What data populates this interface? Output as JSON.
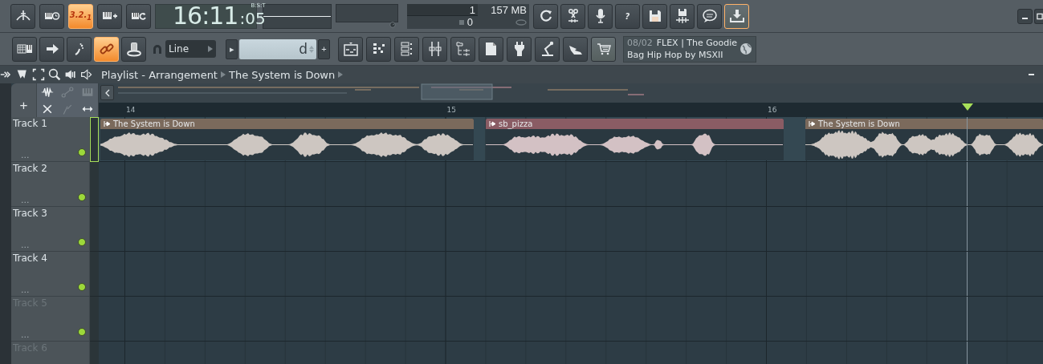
{
  "toolbar": {
    "transport_buttons": [
      {
        "on": false
      },
      {
        "on": false
      },
      {
        "on": true,
        "label": "3.2.$_{1}$"
      },
      {
        "on": false
      },
      {
        "on": false
      }
    ],
    "clock": {
      "time": "16:11",
      "ticks": ":05",
      "format": "B:S:T"
    },
    "stats": {
      "pattern": "1",
      "memory": "157 MB",
      "polyphony": "0"
    },
    "tool_buttons": [
      {
        "on": false
      },
      {
        "on": false
      },
      {
        "on": false
      },
      {
        "on": false,
        "label": "?"
      },
      {
        "on": false
      },
      {
        "on": false
      },
      {
        "on": false
      },
      {
        "on": true
      }
    ],
    "edit_buttons": [
      {
        "on": false
      },
      {
        "on": false
      },
      {
        "on": false
      },
      {
        "on": true
      },
      {
        "on": false
      }
    ],
    "snap": {
      "value": "Line"
    },
    "pattern_field": {
      "prev": "▸",
      "value": "d",
      "add": "+"
    },
    "window_buttons": [
      {
        "on": false
      },
      {
        "on": false
      },
      {
        "on": false
      },
      {
        "on": false
      },
      {
        "on": false
      },
      {
        "on": false
      },
      {
        "on": false
      },
      {
        "on": false
      },
      {
        "on": false
      },
      {
        "on": true
      }
    ],
    "news": {
      "date": "08/02",
      "headline": "FLEX | The Goodie",
      "subline": "Bag Hip Hop by MSXII"
    }
  },
  "playlist": {
    "title": "Playlist - Arrangement",
    "arrangement": "The System is Down",
    "tools": [
      {
        "label": "+"
      },
      {
        "disabled": false
      },
      {
        "disabled": true
      },
      {
        "disabled": true
      },
      {
        "disabled": false
      },
      {
        "disabled": true
      },
      {
        "disabled": false
      }
    ],
    "ruler": [
      "14",
      "15",
      "16"
    ],
    "tracks": [
      {
        "name": "Track 1",
        "dots": "...",
        "dimmed": false,
        "active": true,
        "selected": true,
        "clips": [
          {
            "name": "The System is Down",
            "color": "#7b6a5c"
          },
          {
            "name": "sb_pizza",
            "color": "#8a5c64"
          },
          {
            "name": "The System is Down",
            "color": "#7b6a5c"
          }
        ]
      },
      {
        "name": "Track 2",
        "dots": "...",
        "dimmed": false,
        "active": true,
        "selected": false
      },
      {
        "name": "Track 3",
        "dots": "...",
        "dimmed": false,
        "active": true,
        "selected": false
      },
      {
        "name": "Track 4",
        "dots": "...",
        "dimmed": false,
        "active": true,
        "selected": false
      },
      {
        "name": "Track 5",
        "dots": "...",
        "dimmed": true,
        "active": true,
        "selected": false
      },
      {
        "name": "Track 6",
        "dimmed": true,
        "selected": false
      }
    ]
  }
}
